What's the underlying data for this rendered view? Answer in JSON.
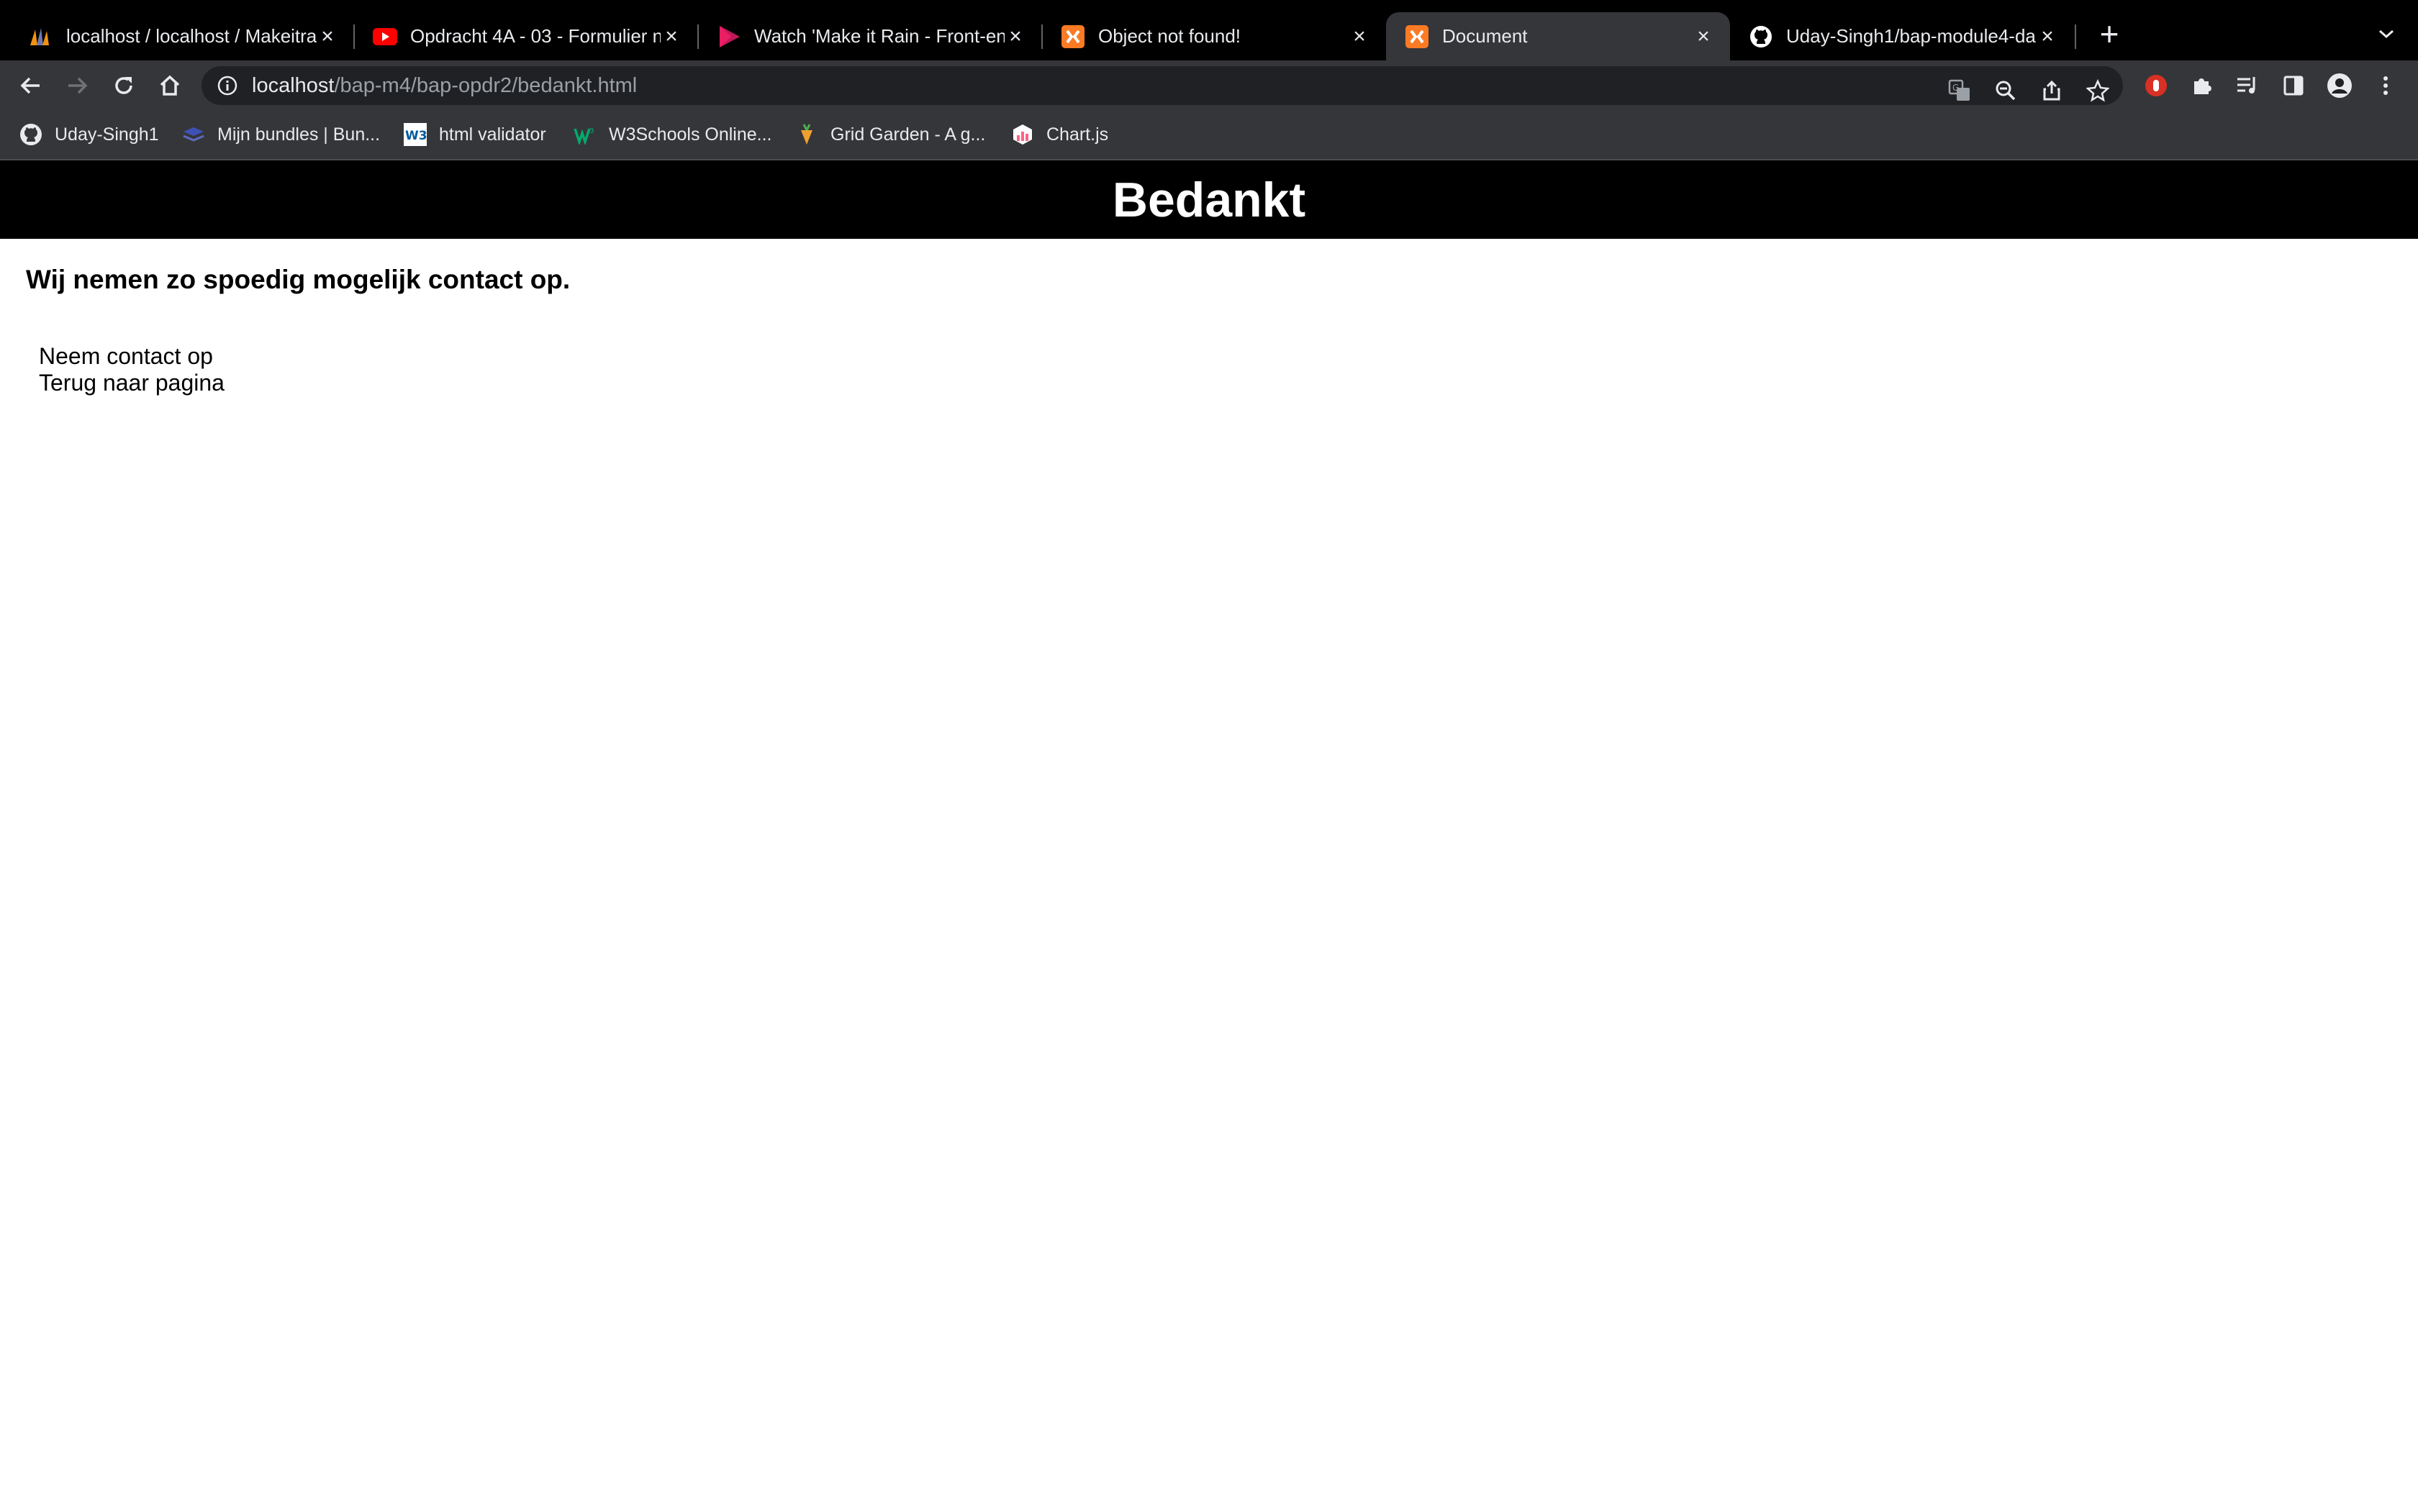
{
  "browser": {
    "tabs": [
      {
        "title": "localhost / localhost / Makeitra",
        "favicon": "phpmyadmin-icon",
        "active": false
      },
      {
        "title": "Opdracht 4A - 03 - Formulier n",
        "favicon": "youtube-icon",
        "active": false
      },
      {
        "title": "Watch 'Make it Rain - Front-en",
        "favicon": "play-icon",
        "active": false
      },
      {
        "title": "Object not found!",
        "favicon": "xampp-icon",
        "active": false
      },
      {
        "title": "Document",
        "favicon": "xampp-icon",
        "active": true
      },
      {
        "title": "Uday-Singh1/bap-module4-da",
        "favicon": "github-icon",
        "active": false
      }
    ],
    "address": {
      "host": "localhost",
      "path": "/bap-m4/bap-opdr2/bedankt.html"
    },
    "bookmarks": [
      {
        "label": "Uday-Singh1",
        "icon": "github-icon"
      },
      {
        "label": "Mijn bundles | Bun...",
        "icon": "bundle-icon"
      },
      {
        "label": "html validator",
        "icon": "w3c-icon"
      },
      {
        "label": "W3Schools Online...",
        "icon": "w3schools-icon"
      },
      {
        "label": "Grid Garden - A g...",
        "icon": "carrot-icon"
      },
      {
        "label": "Chart.js",
        "icon": "chartjs-icon"
      }
    ]
  },
  "page": {
    "header_title": "Bedankt",
    "subtitle": "Wij nemen zo spoedig mogelijk contact op.",
    "links": [
      {
        "label": "Neem contact op"
      },
      {
        "label": "Terug naar pagina"
      }
    ]
  },
  "colors": {
    "tabstrip": "#000000",
    "toolbar": "#35363a",
    "page_header": "#000000",
    "youtube": "#ff0000",
    "xampp": "#fb7a24"
  }
}
